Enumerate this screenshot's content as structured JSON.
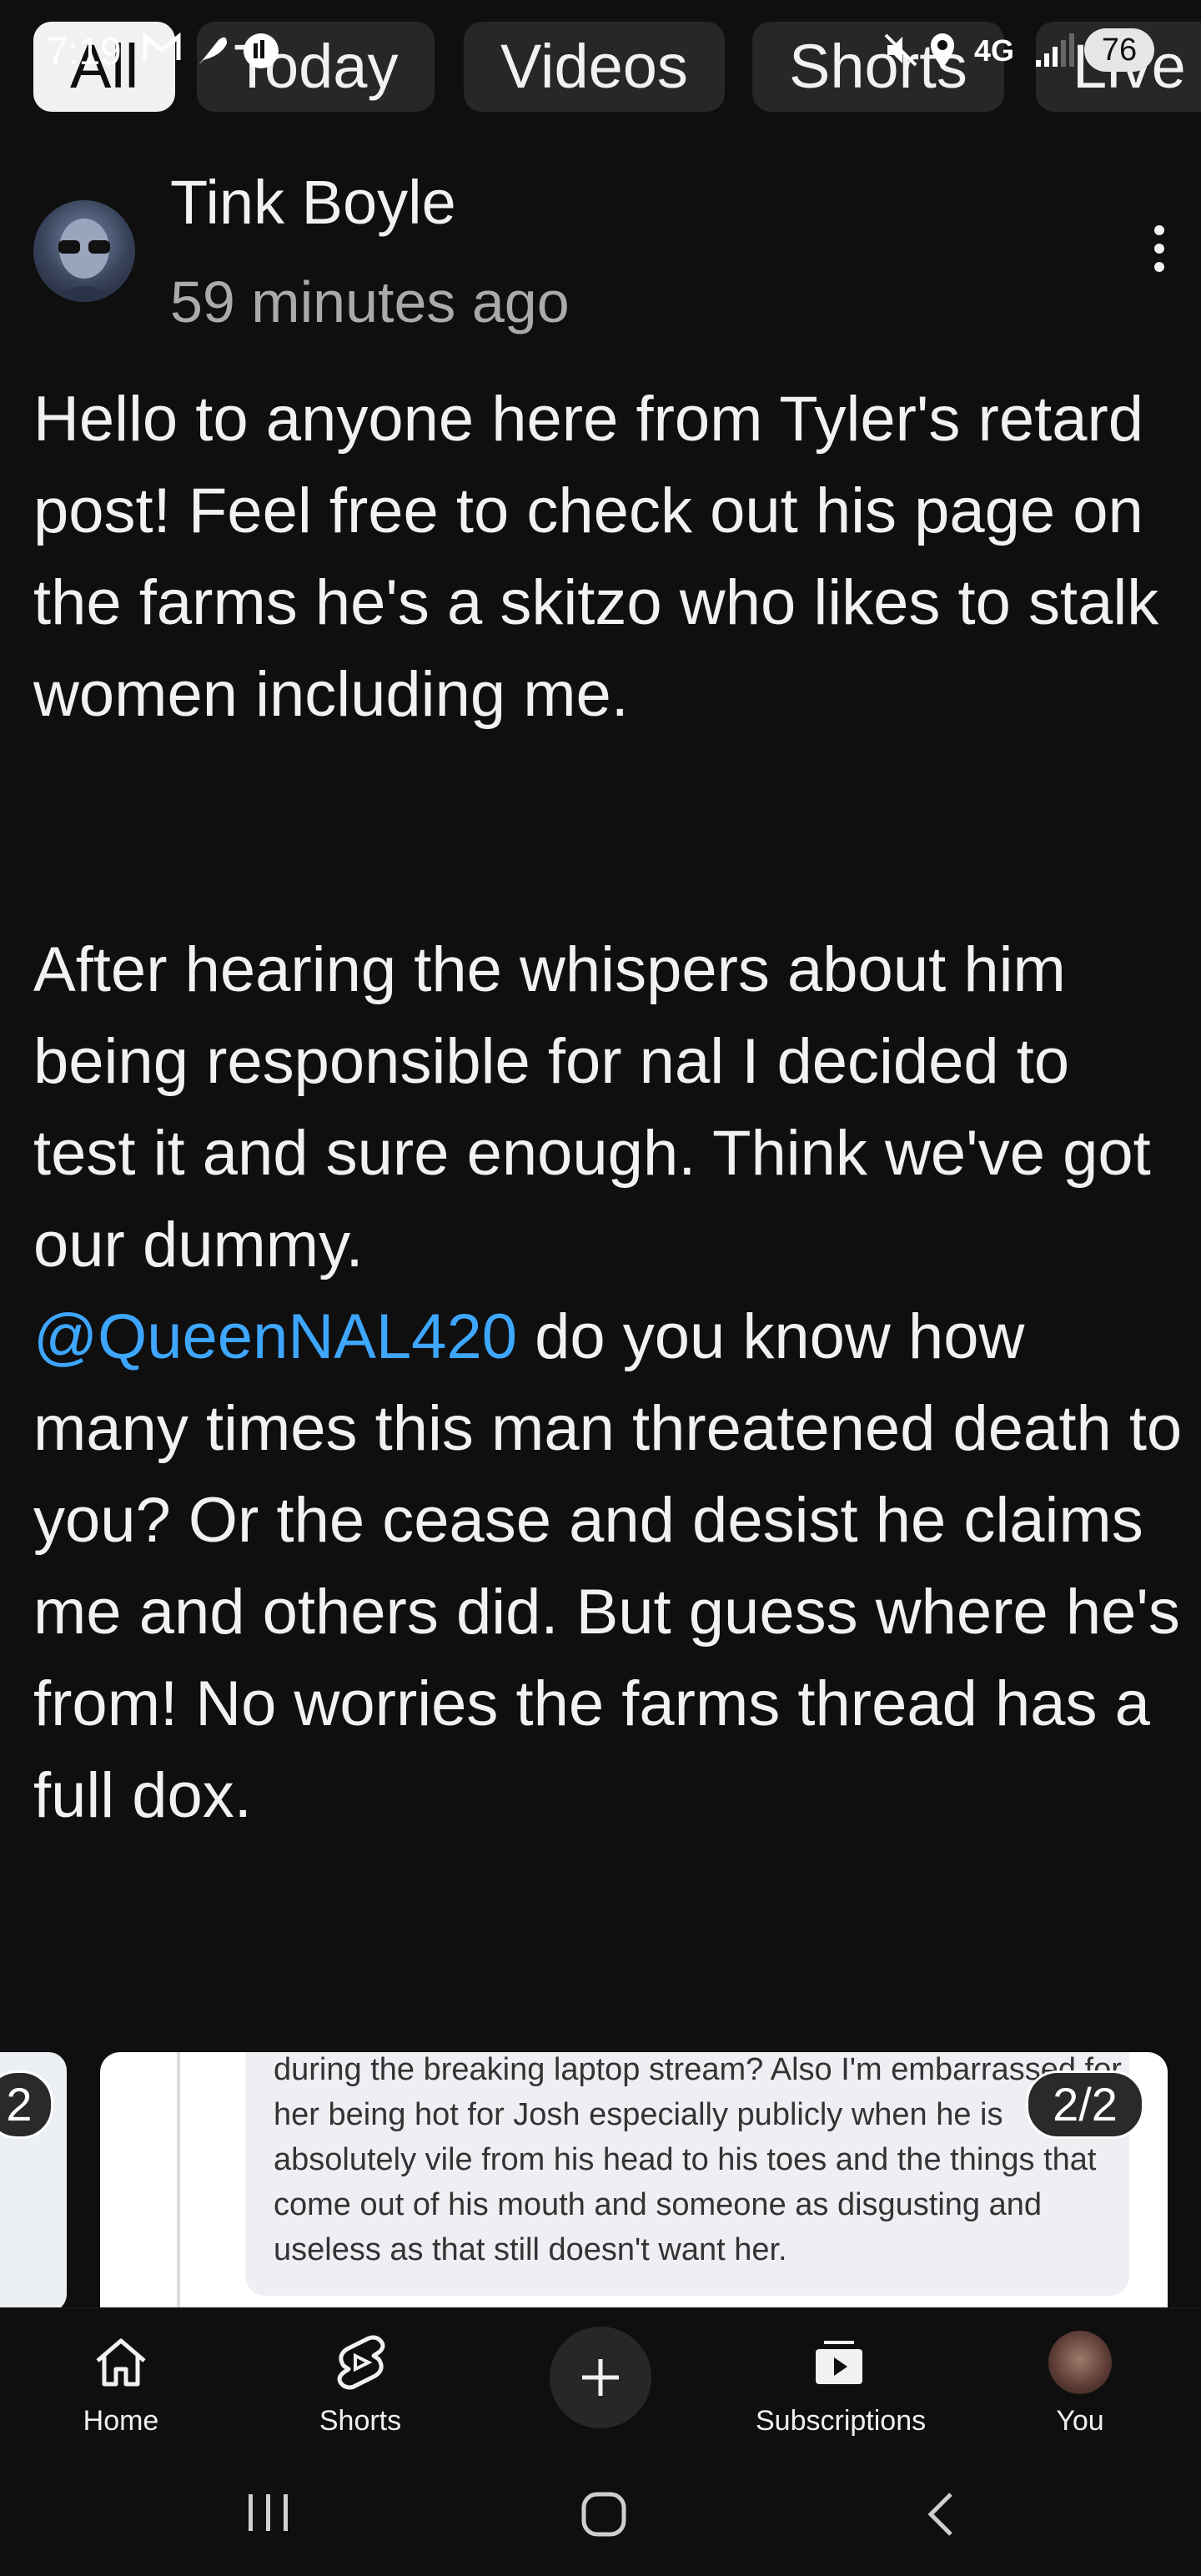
{
  "status_bar": {
    "time": "7:19",
    "network": "4G",
    "battery": "76",
    "icons": [
      "gmail-icon",
      "feather-icon",
      "recording-icon",
      "mute-icon",
      "location-icon",
      "signal-icon"
    ]
  },
  "chips": [
    {
      "label": "All",
      "active": true
    },
    {
      "label": "Today",
      "active": false
    },
    {
      "label": "Videos",
      "active": false
    },
    {
      "label": "Shorts",
      "active": false
    },
    {
      "label": "Live",
      "active": false
    }
  ],
  "post": {
    "author": "Tink Boyle",
    "time": "59 minutes ago",
    "paragraph1": "Hello to anyone here from Tyler's retard post!  Feel free to check out his page on the farms he's a skitzo who likes to stalk women including me.",
    "paragraph2_before_mention": "After hearing the whispers about him being responsible for nal I decided to test it and sure enough. Think we've got our dummy.",
    "mention": "@QueenNAL420",
    "paragraph2_after_mention": " do you know how many times this man threatened death to you? Or the cease and desist he claims me and others did. But guess where he's from!  No worries the farms thread has a full dox."
  },
  "carousel": {
    "prev_counter": "2",
    "counter": "2/2",
    "screenshot_text": "during the breaking laptop stream? Also I'm embarrassed for her being hot for Josh especially publicly  when he is absolutely vile from his head to his toes and the things that come out of his mouth and someone as disgusting and useless as that still doesn't want her."
  },
  "bottom_nav": [
    {
      "label": "Home",
      "icon": "home-icon"
    },
    {
      "label": "Shorts",
      "icon": "shorts-icon"
    },
    {
      "label": "",
      "icon": "plus-icon"
    },
    {
      "label": "Subscriptions",
      "icon": "subscriptions-icon"
    },
    {
      "label": "You",
      "icon": "avatar"
    }
  ],
  "colors": {
    "background": "#0f0f0f",
    "text": "#f1f1f1",
    "secondary_text": "#aaaaaa",
    "mention": "#3ea6ff",
    "chip": "#272727"
  }
}
